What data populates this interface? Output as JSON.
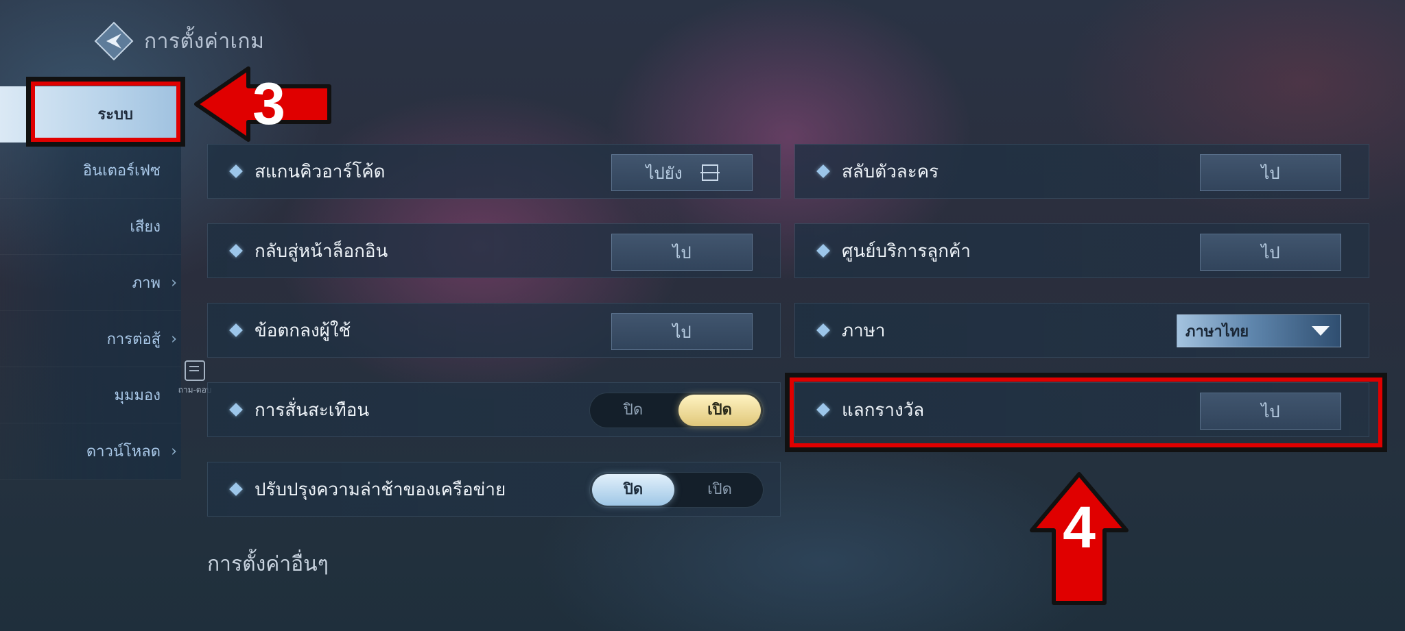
{
  "header": {
    "title": "การตั้งค่าเกม",
    "logo_icon": "game-logo-icon"
  },
  "sidebar": {
    "items": [
      {
        "label": "ระบบ",
        "active": true,
        "chevron": false
      },
      {
        "label": "อินเตอร์เฟซ",
        "active": false,
        "chevron": false
      },
      {
        "label": "เสียง",
        "active": false,
        "chevron": false
      },
      {
        "label": "ภาพ",
        "active": false,
        "chevron": true
      },
      {
        "label": "การต่อสู้",
        "active": false,
        "chevron": true
      },
      {
        "label": "มุมมอง",
        "active": false,
        "chevron": false
      },
      {
        "label": "ดาวน์โหลด",
        "active": false,
        "chevron": true
      }
    ]
  },
  "qa": {
    "label": "ถาม-ตอบ",
    "icon": "faq-icon"
  },
  "settings": {
    "left": [
      {
        "label": "สแกนคิวอาร์โค้ด",
        "control": "button",
        "button_label": "ไปยัง",
        "icon": "scan-icon"
      },
      {
        "label": "กลับสู่หน้าล็อกอิน",
        "control": "button",
        "button_label": "ไป"
      },
      {
        "label": "ข้อตกลงผู้ใช้",
        "control": "button",
        "button_label": "ไป"
      },
      {
        "label": "การสั่นสะเทือน",
        "control": "toggle",
        "off_label": "ปิด",
        "on_label": "เปิด",
        "value": "เปิด"
      },
      {
        "label": "ปรับปรุงความล่าช้าของเครือข่าย",
        "control": "toggle",
        "off_label": "ปิด",
        "on_label": "เปิด",
        "value": "ปิด"
      }
    ],
    "right": [
      {
        "label": "สลับตัวละคร",
        "control": "button",
        "button_label": "ไป"
      },
      {
        "label": "ศูนย์บริการลูกค้า",
        "control": "button",
        "button_label": "ไป"
      },
      {
        "label": "ภาษา",
        "control": "select",
        "selected": "ภาษาไทย"
      },
      {
        "label": "แลกรางวัล",
        "control": "button",
        "button_label": "ไป"
      }
    ]
  },
  "other_settings_title": "การตั้งค่าอื่นๆ",
  "annotations": {
    "step3": "3",
    "step4": "4",
    "color": "#e00000"
  }
}
